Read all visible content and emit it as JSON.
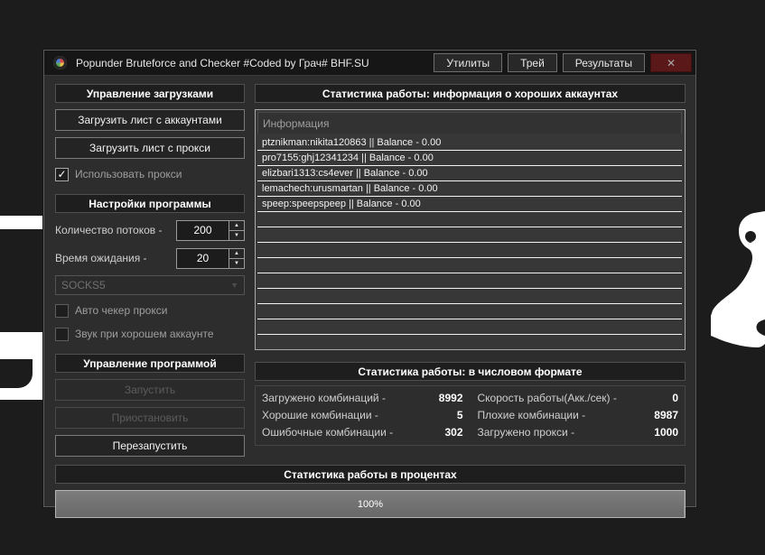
{
  "icons": {
    "checkmark": "✓",
    "close": "✕",
    "dropdown_arrow": "▼",
    "spin_up": "▲",
    "spin_down": "▼"
  },
  "window": {
    "title": "Popunder Bruteforce and Checker #Coded by Грач# BHF.SU",
    "buttons": [
      {
        "label": "Утилиты"
      },
      {
        "label": "Трей"
      },
      {
        "label": "Результаты"
      }
    ]
  },
  "left_panel": {
    "downloads": {
      "header": "Управление загрузками",
      "load_accounts_button": "Загрузить лист с аккаунтами",
      "load_proxy_button": "Загрузить лист с прокси",
      "use_proxy_checkbox": {
        "label": "Использовать прокси",
        "checked": true
      }
    },
    "settings": {
      "header": "Настройки программы",
      "threads": {
        "label": "Количество потоков -",
        "value": "200"
      },
      "timeout": {
        "label": "Время ожидания -",
        "value": "20"
      },
      "proxy_type": {
        "value": "SOCKS5"
      },
      "auto_check_checkbox": {
        "label": "Авто чекер прокси",
        "checked": false
      },
      "sound_checkbox": {
        "label": "Звук при хорошем аккаунте",
        "checked": false
      }
    },
    "control": {
      "header": "Управление программой",
      "start_button": {
        "label": "Запустить",
        "enabled": false
      },
      "pause_button": {
        "label": "Приостановить",
        "enabled": false
      },
      "restart_button": {
        "label": "Перезапустить",
        "enabled": true
      }
    }
  },
  "accounts_section": {
    "header": "Статистика работы: информация о хороших аккаунтах",
    "list_header": "Информация",
    "rows": [
      "ptznikman:nikita120863 || Balance - 0.00",
      "pro7155:ghj12341234 || Balance - 0.00",
      "elizbari1313:cs4ever || Balance - 0.00",
      "lemachech:urusmartan || Balance - 0.00",
      "speep:speepspeep || Balance - 0.00"
    ],
    "empty_row_count": 9
  },
  "numeric_stats": {
    "header": "Статистика работы: в числовом формате",
    "items": [
      {
        "label": "Загружено комбинаций -",
        "value": "8992"
      },
      {
        "label": "Скорость работы(Акк./сек) -",
        "value": "0"
      },
      {
        "label": "Хорошие комбинации -",
        "value": "5"
      },
      {
        "label": "Плохие комбинации -",
        "value": "8987"
      },
      {
        "label": "Ошибочные комбинации -",
        "value": "302"
      },
      {
        "label": "Загружено прокси -",
        "value": "1000"
      }
    ]
  },
  "progress_section": {
    "header": "Статистика работы в процентах",
    "percent": 100,
    "percent_label": "100%"
  },
  "colors": {
    "page_bg": "#1c1c1c",
    "window_bg": "#2d2d2d",
    "titlebar_bg": "#161616",
    "header_bg": "#1e1e1e",
    "close_button_bg": "#5a1818",
    "list_bg": "#373737",
    "progress_fill": "#6f6f6f",
    "decoration": "#ffffff"
  }
}
